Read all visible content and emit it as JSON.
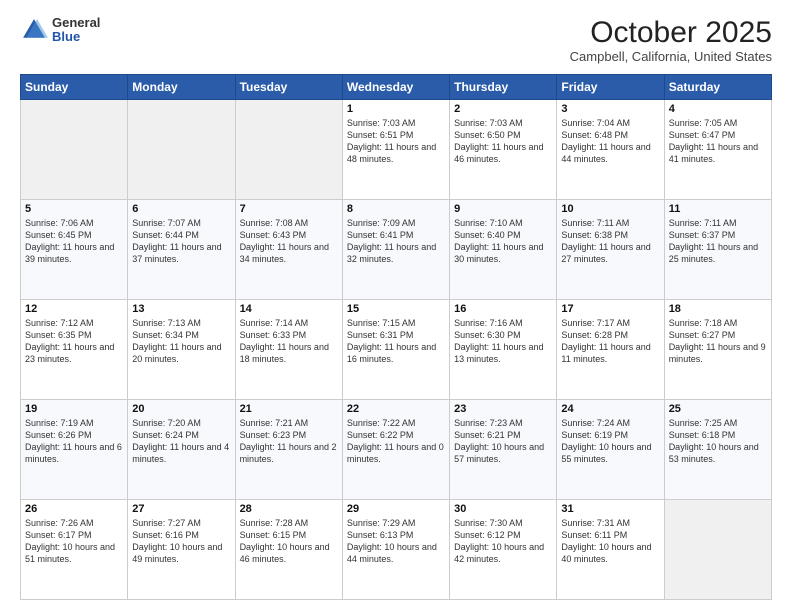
{
  "logo": {
    "general": "General",
    "blue": "Blue"
  },
  "header": {
    "month": "October 2025",
    "location": "Campbell, California, United States"
  },
  "days_of_week": [
    "Sunday",
    "Monday",
    "Tuesday",
    "Wednesday",
    "Thursday",
    "Friday",
    "Saturday"
  ],
  "weeks": [
    [
      {
        "day": "",
        "info": ""
      },
      {
        "day": "",
        "info": ""
      },
      {
        "day": "",
        "info": ""
      },
      {
        "day": "1",
        "info": "Sunrise: 7:03 AM\nSunset: 6:51 PM\nDaylight: 11 hours and 48 minutes."
      },
      {
        "day": "2",
        "info": "Sunrise: 7:03 AM\nSunset: 6:50 PM\nDaylight: 11 hours and 46 minutes."
      },
      {
        "day": "3",
        "info": "Sunrise: 7:04 AM\nSunset: 6:48 PM\nDaylight: 11 hours and 44 minutes."
      },
      {
        "day": "4",
        "info": "Sunrise: 7:05 AM\nSunset: 6:47 PM\nDaylight: 11 hours and 41 minutes."
      }
    ],
    [
      {
        "day": "5",
        "info": "Sunrise: 7:06 AM\nSunset: 6:45 PM\nDaylight: 11 hours and 39 minutes."
      },
      {
        "day": "6",
        "info": "Sunrise: 7:07 AM\nSunset: 6:44 PM\nDaylight: 11 hours and 37 minutes."
      },
      {
        "day": "7",
        "info": "Sunrise: 7:08 AM\nSunset: 6:43 PM\nDaylight: 11 hours and 34 minutes."
      },
      {
        "day": "8",
        "info": "Sunrise: 7:09 AM\nSunset: 6:41 PM\nDaylight: 11 hours and 32 minutes."
      },
      {
        "day": "9",
        "info": "Sunrise: 7:10 AM\nSunset: 6:40 PM\nDaylight: 11 hours and 30 minutes."
      },
      {
        "day": "10",
        "info": "Sunrise: 7:11 AM\nSunset: 6:38 PM\nDaylight: 11 hours and 27 minutes."
      },
      {
        "day": "11",
        "info": "Sunrise: 7:11 AM\nSunset: 6:37 PM\nDaylight: 11 hours and 25 minutes."
      }
    ],
    [
      {
        "day": "12",
        "info": "Sunrise: 7:12 AM\nSunset: 6:35 PM\nDaylight: 11 hours and 23 minutes."
      },
      {
        "day": "13",
        "info": "Sunrise: 7:13 AM\nSunset: 6:34 PM\nDaylight: 11 hours and 20 minutes."
      },
      {
        "day": "14",
        "info": "Sunrise: 7:14 AM\nSunset: 6:33 PM\nDaylight: 11 hours and 18 minutes."
      },
      {
        "day": "15",
        "info": "Sunrise: 7:15 AM\nSunset: 6:31 PM\nDaylight: 11 hours and 16 minutes."
      },
      {
        "day": "16",
        "info": "Sunrise: 7:16 AM\nSunset: 6:30 PM\nDaylight: 11 hours and 13 minutes."
      },
      {
        "day": "17",
        "info": "Sunrise: 7:17 AM\nSunset: 6:28 PM\nDaylight: 11 hours and 11 minutes."
      },
      {
        "day": "18",
        "info": "Sunrise: 7:18 AM\nSunset: 6:27 PM\nDaylight: 11 hours and 9 minutes."
      }
    ],
    [
      {
        "day": "19",
        "info": "Sunrise: 7:19 AM\nSunset: 6:26 PM\nDaylight: 11 hours and 6 minutes."
      },
      {
        "day": "20",
        "info": "Sunrise: 7:20 AM\nSunset: 6:24 PM\nDaylight: 11 hours and 4 minutes."
      },
      {
        "day": "21",
        "info": "Sunrise: 7:21 AM\nSunset: 6:23 PM\nDaylight: 11 hours and 2 minutes."
      },
      {
        "day": "22",
        "info": "Sunrise: 7:22 AM\nSunset: 6:22 PM\nDaylight: 11 hours and 0 minutes."
      },
      {
        "day": "23",
        "info": "Sunrise: 7:23 AM\nSunset: 6:21 PM\nDaylight: 10 hours and 57 minutes."
      },
      {
        "day": "24",
        "info": "Sunrise: 7:24 AM\nSunset: 6:19 PM\nDaylight: 10 hours and 55 minutes."
      },
      {
        "day": "25",
        "info": "Sunrise: 7:25 AM\nSunset: 6:18 PM\nDaylight: 10 hours and 53 minutes."
      }
    ],
    [
      {
        "day": "26",
        "info": "Sunrise: 7:26 AM\nSunset: 6:17 PM\nDaylight: 10 hours and 51 minutes."
      },
      {
        "day": "27",
        "info": "Sunrise: 7:27 AM\nSunset: 6:16 PM\nDaylight: 10 hours and 49 minutes."
      },
      {
        "day": "28",
        "info": "Sunrise: 7:28 AM\nSunset: 6:15 PM\nDaylight: 10 hours and 46 minutes."
      },
      {
        "day": "29",
        "info": "Sunrise: 7:29 AM\nSunset: 6:13 PM\nDaylight: 10 hours and 44 minutes."
      },
      {
        "day": "30",
        "info": "Sunrise: 7:30 AM\nSunset: 6:12 PM\nDaylight: 10 hours and 42 minutes."
      },
      {
        "day": "31",
        "info": "Sunrise: 7:31 AM\nSunset: 6:11 PM\nDaylight: 10 hours and 40 minutes."
      },
      {
        "day": "",
        "info": ""
      }
    ]
  ]
}
